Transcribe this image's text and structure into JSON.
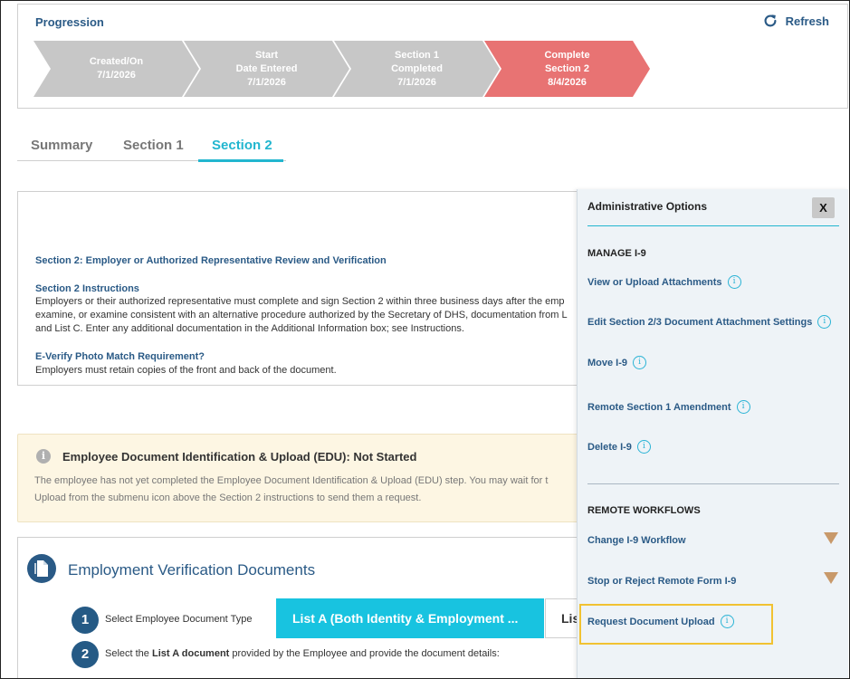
{
  "progression": {
    "title": "Progression",
    "refresh_label": "Refresh",
    "steps": [
      {
        "line1": "Created/On",
        "line2": "7/1/2026",
        "line3": "",
        "status": "done"
      },
      {
        "line1": "Start",
        "line2": "Date Entered",
        "line3": "7/1/2026",
        "status": "done"
      },
      {
        "line1": "Section 1",
        "line2": "Completed",
        "line3": "7/1/2026",
        "status": "done"
      },
      {
        "line1": "Complete",
        "line2": "Section 2",
        "line3": "8/4/2026",
        "status": "current"
      }
    ],
    "colors": {
      "done": "#c7c7c7",
      "current": "#e87373"
    }
  },
  "tabs": [
    {
      "label": "Summary",
      "active": false
    },
    {
      "label": "Section 1",
      "active": false
    },
    {
      "label": "Section 2",
      "active": true
    }
  ],
  "instructions": {
    "heading": "Section 2: Employer or Authorized Representative Review and Verification",
    "sub_heading": "Section 2 Instructions",
    "body_line1": "Employers or their authorized representative must complete and sign Section 2 within three business days after the emp",
    "body_line2": "examine, or examine consistent with an alternative procedure authorized by the Secretary of DHS, documentation from L",
    "body_line3": "and List C. Enter any additional documentation in the Additional Information box; see Instructions.",
    "everify_heading": "E-Verify Photo Match Requirement?",
    "everify_body": "Employers must retain copies of the front and back of the document."
  },
  "edu": {
    "info_glyph": "i",
    "title": "Employee Document Identification & Upload (EDU): Not Started",
    "line1": "The employee has not yet completed the Employee Document Identification & Upload (EDU) step. You may wait for t",
    "line2": "Upload from the submenu icon above the Section 2 instructions to send them a request."
  },
  "verification": {
    "title": "Employment Verification Documents",
    "step1_num": "1",
    "step1_label": "Select Employee Document Type",
    "list_a_label": "List A (Both Identity & Employment ...",
    "list_b_label": "Lis",
    "step2_num": "2",
    "step2_prefix": "Select the ",
    "step2_bold": "List A document",
    "step2_suffix": " provided by the Employee and provide the document details:"
  },
  "admin": {
    "title": "Administrative Options",
    "close_label": "X",
    "info_glyph": "i",
    "manage_heading": "MANAGE I-9",
    "manage_items": [
      "View or Upload Attachments",
      "Edit Section 2/3 Document Attachment Settings",
      "Move I-9",
      "Remote Section 1 Amendment",
      "Delete I-9"
    ],
    "remote_heading": "REMOTE WORKFLOWS",
    "remote_items": [
      "Change I-9 Workflow",
      "Stop or Reject Remote Form I-9",
      "Request Document Upload"
    ],
    "colors": {
      "accent": "#22b6cf",
      "link": "#2a5a86",
      "highlight": "#f1c232"
    }
  }
}
